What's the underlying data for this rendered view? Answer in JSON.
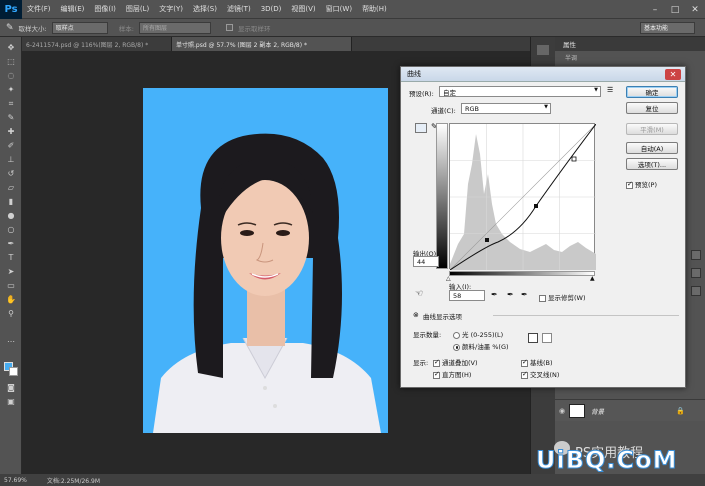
{
  "app": {
    "logo": "Ps",
    "menu": [
      "文件(F)",
      "编辑(E)",
      "图像(I)",
      "图层(L)",
      "文字(Y)",
      "选择(S)",
      "滤镜(T)",
      "3D(D)",
      "视图(V)",
      "窗口(W)",
      "帮助(H)"
    ],
    "window_controls": [
      "–",
      "□",
      "✕"
    ]
  },
  "options": {
    "sample_size_label": "取样大小:",
    "sample_size_value": "取样点",
    "sample_label": "样本:",
    "sample_value": "所有图层",
    "show_ring_label": "显示取样环",
    "workspace": "基本功能"
  },
  "tabs": [
    {
      "label": "6-2411574.psd @ 116%(图层 2, RGB/8) *"
    },
    {
      "label": "单寸照.psd @ 57.7% (图层 2 副本 2, RGB/8) *"
    }
  ],
  "panel": {
    "title": "属性",
    "subtitle": "半调",
    "layers": [
      {
        "name": "背景"
      }
    ]
  },
  "status": {
    "zoom": "57.69%",
    "doc": "文档:2.25M/26.9M"
  },
  "dialog": {
    "title": "曲线",
    "close": "✕",
    "preset_label": "预设(R):",
    "preset_value": "自定",
    "channel_label": "通道(C):",
    "channel_value": "RGB",
    "output_label": "输出(O):",
    "output_value": "44",
    "input_label": "输入(I):",
    "input_value": "58",
    "show_clipping": "显示修剪(W)",
    "display_options": "曲线显示选项",
    "show_amount_label": "显示数量:",
    "light": "光 (0-255)(L)",
    "pigment": "颜料/油墨 %(G)",
    "show_label": "显示:",
    "channel_overlay": "通道叠加(V)",
    "baseline": "基线(B)",
    "histogram": "直方图(H)",
    "intersection": "交叉线(N)",
    "buttons": {
      "ok": "确定",
      "reset": "复位",
      "smooth": "平滑(M)",
      "auto": "自动(A)",
      "options": "选项(T)..."
    },
    "preview": "预览(P)"
  },
  "watermark": {
    "brand": "UiBQ.CoM",
    "text": "PS实用教程"
  }
}
